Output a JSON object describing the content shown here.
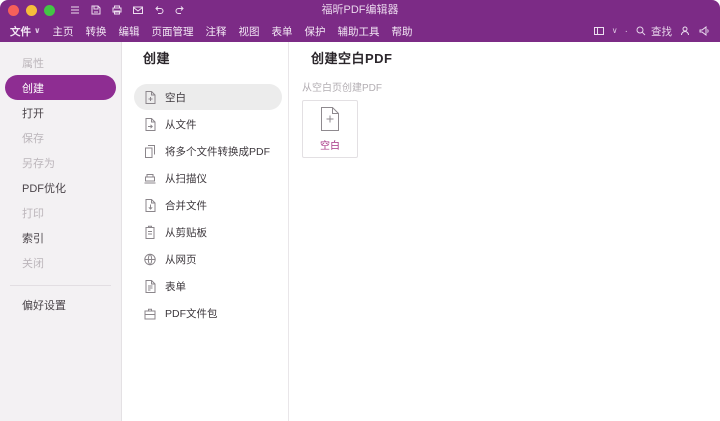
{
  "colors": {
    "titlebar_bg": "#7c2b86",
    "selected_pill": "#8e2d92",
    "card_label": "#a63384",
    "traffic_red": "#f5605a",
    "traffic_yellow": "#f6bd3b",
    "traffic_green": "#43c645"
  },
  "titlebar": {
    "title": "福昕PDF编辑器",
    "quick_icons": [
      "menu-icon",
      "save-icon",
      "print-icon",
      "email-icon",
      "undo-icon",
      "redo-icon"
    ]
  },
  "menubar": {
    "caret": "∨",
    "divider": "·",
    "items": [
      {
        "label": "文件"
      },
      {
        "label": "主页"
      },
      {
        "label": "转换"
      },
      {
        "label": "编辑"
      },
      {
        "label": "页面管理"
      },
      {
        "label": "注释"
      },
      {
        "label": "视图"
      },
      {
        "label": "表单"
      },
      {
        "label": "保护"
      },
      {
        "label": "辅助工具"
      },
      {
        "label": "帮助"
      }
    ],
    "search_label": "查找",
    "right_icons": [
      "panel-switch-icon",
      "search-icon",
      "account-icon",
      "megaphone-icon"
    ]
  },
  "sidebar": {
    "items": [
      {
        "label": "属性",
        "state": "disabled"
      },
      {
        "label": "创建",
        "state": "selected"
      },
      {
        "label": "打开",
        "state": "enabled"
      },
      {
        "label": "保存",
        "state": "disabled"
      },
      {
        "label": "另存为",
        "state": "disabled"
      },
      {
        "label": "PDF优化",
        "state": "enabled"
      },
      {
        "label": "打印",
        "state": "disabled"
      },
      {
        "label": "索引",
        "state": "enabled"
      },
      {
        "label": "关闭",
        "state": "disabled"
      }
    ],
    "preferences": {
      "label": "偏好设置"
    }
  },
  "create_panel": {
    "title": "创建",
    "items": [
      {
        "label": "空白",
        "icon": "blank-document-icon",
        "selected": true
      },
      {
        "label": "从文件",
        "icon": "from-file-icon",
        "selected": false
      },
      {
        "label": "将多个文件转换成PDF",
        "icon": "multiple-files-icon",
        "selected": false
      },
      {
        "label": "从扫描仪",
        "icon": "scanner-icon",
        "selected": false
      },
      {
        "label": "合并文件",
        "icon": "combine-files-icon",
        "selected": false
      },
      {
        "label": "从剪贴板",
        "icon": "clipboard-icon",
        "selected": false
      },
      {
        "label": "从网页",
        "icon": "web-page-icon",
        "selected": false
      },
      {
        "label": "表单",
        "icon": "form-icon",
        "selected": false
      },
      {
        "label": "PDF文件包",
        "icon": "pdf-portfolio-icon",
        "selected": false
      }
    ]
  },
  "detail_panel": {
    "title": "创建空白PDF",
    "subtitle": "从空白页创建PDF",
    "card": {
      "label": "空白",
      "icon": "new-blank-document-icon"
    }
  }
}
